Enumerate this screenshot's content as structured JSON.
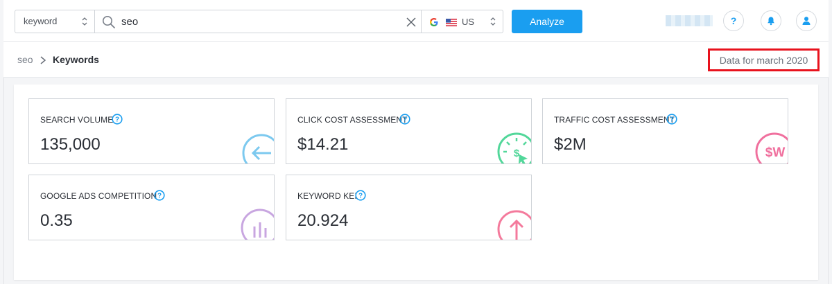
{
  "search": {
    "type_value": "keyword",
    "query": "seo",
    "country_code": "US",
    "analyze_label": "Analyze"
  },
  "header": {
    "help_glyph": "?"
  },
  "breadcrumb": {
    "root": "seo",
    "current": "Keywords"
  },
  "data_date": "Data for march 2020",
  "cards": [
    {
      "label": "SEARCH VOLUME",
      "value": "135,000",
      "icon": "arrow-left-icon",
      "color": "#7cc9ef"
    },
    {
      "label": "CLICK COST ASSESSMENT",
      "value": "$14.21",
      "icon": "click-cost-icon",
      "color": "#52d79a"
    },
    {
      "label": "TRAFFIC COST ASSESSMENT",
      "value": "$2M",
      "icon": "traffic-cost-icon",
      "color": "#f0709e"
    },
    {
      "label": "GOOGLE ADS COMPETITION",
      "value": "0.35",
      "icon": "bar-chart-icon",
      "color": "#c8a6e0"
    },
    {
      "label": "KEYWORD KEI",
      "value": "20.924",
      "icon": "arrow-up-icon",
      "color": "#f47a9c"
    }
  ],
  "traffic_icon_text": "$W",
  "click_icon_text": "$",
  "colors": {
    "accent": "#1a9ef0",
    "highlight_border": "#e8121d"
  }
}
